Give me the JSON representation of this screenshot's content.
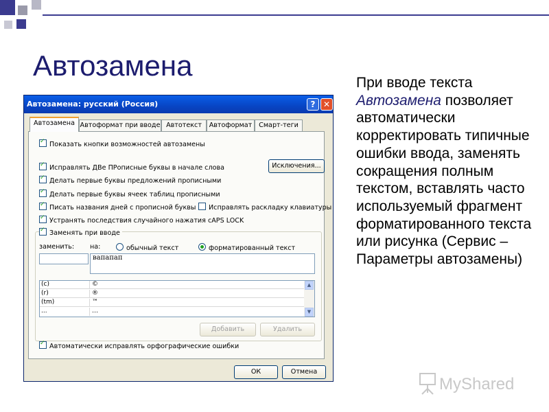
{
  "slide": {
    "title": "Автозамена",
    "body_before": "При вводе текста",
    "body_italic": "Автозамена",
    "body_after": "позволяет автоматически корректировать типичные ошибки ввода, заменять сокращения полным текстом, вставлять часто используемый фрагмент форматированного текста или рисунка (Сервис – Параметры автозамены)",
    "watermark": "MyShared",
    "colors": {
      "title": "#1c1c6e",
      "deco_blue": "#3b3b8f",
      "deco_gray": "#9a9aaa"
    }
  },
  "dialog": {
    "title": "Автозамена: русский (Россия)",
    "help_button": "?",
    "close_button": "✕",
    "tabs": [
      "Автозамена",
      "Автоформат при вводе",
      "Автотекст",
      "Автоформат",
      "Смарт-теги"
    ],
    "active_tab": "Автозамена",
    "show_buttons": {
      "label": "Показать кнопки возможностей автозамены",
      "checked": true
    },
    "options": [
      {
        "label": "Исправлять ДВе ПРописные буквы в начале слова",
        "checked": true
      },
      {
        "label": "Делать первые буквы предложений прописными",
        "checked": true
      },
      {
        "label": "Делать первые буквы ячеек таблиц прописными",
        "checked": true
      },
      {
        "label": "Писать названия дней с прописной буквы",
        "checked": true
      },
      {
        "label": "Устранять последствия случайного нажатия cAPS LOCK",
        "checked": true
      }
    ],
    "keyboard_option": {
      "label": "Исправлять раскладку клавиатуры",
      "checked": false
    },
    "exceptions_button": "Исключения...",
    "replace_group": {
      "label": "Заменять при вводе",
      "checked": true,
      "replace_label": "заменить:",
      "with_label": "на:",
      "plain_text": "обычный текст",
      "formatted_text": "форматированный текст",
      "selected": "форматированный текст",
      "replace_value": "",
      "with_value": "вапапап"
    },
    "list": [
      {
        "from": "(c)",
        "to": "©"
      },
      {
        "from": "(r)",
        "to": "®"
      },
      {
        "from": "(tm)",
        "to": "™"
      },
      {
        "from": "...",
        "to": "…"
      }
    ],
    "add_button": "Добавить",
    "delete_button": "Удалить",
    "spelling_option": {
      "label": "Автоматически исправлять орфографические ошибки",
      "checked": true
    },
    "ok_button": "ОК",
    "cancel_button": "Отмена"
  }
}
